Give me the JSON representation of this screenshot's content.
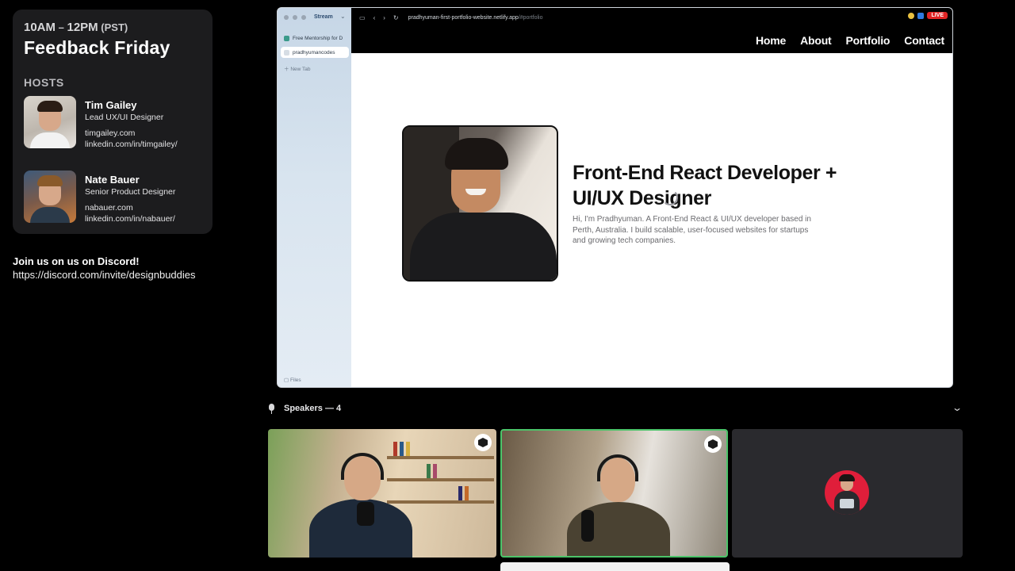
{
  "event": {
    "time_start": "10AM",
    "time_sep": " – ",
    "time_end": "12PM",
    "time_zone": "(PST)",
    "title": "Feedback Friday",
    "hosts_label": "HOSTS",
    "hosts": [
      {
        "name": "Tim Gailey",
        "role": "Lead UX/UI Designer",
        "site": "timgailey.com",
        "linkedin": "linkedin.com/in/timgailey/"
      },
      {
        "name": "Nate Bauer",
        "role": "Senior Product Designer",
        "site": "nabauer.com",
        "linkedin": "linkedin.com/in/nabauer/"
      }
    ],
    "discord_title": "Join us on us on Discord!",
    "discord_url": "https://discord.com/invite/designbuddies"
  },
  "browser": {
    "sidebar_title": "Stream",
    "tabs": [
      {
        "label": "Free Mentorship for D",
        "active": false
      },
      {
        "label": "pradhyumancodes",
        "active": true
      }
    ],
    "new_tab_label": "New Tab",
    "files_label": "Files",
    "url_main": "pradhyuman-first-portfolio-website.netlify.app",
    "url_path": "/#portfolio",
    "live_badge": "LIVE"
  },
  "site": {
    "nav": [
      "Home",
      "About",
      "Portfolio",
      "Contact"
    ],
    "hero_title": "Front-End React Developer + UI/UX Designer",
    "hero_desc": "Hi, I'm Pradhyuman. A Front-End React & UI/UX developer based in Perth, Australia. I build scalable, user-focused websites for startups and growing tech companies."
  },
  "speakers": {
    "label": "Speakers — 4",
    "tiles": [
      {
        "kind": "video",
        "host": true
      },
      {
        "kind": "video",
        "host": true,
        "speaking": true
      },
      {
        "kind": "avatar",
        "host": false
      }
    ]
  },
  "colors": {
    "live": "#e02424",
    "speaking_border": "#4cc46a",
    "avatar_bg": "#e01e3a"
  }
}
